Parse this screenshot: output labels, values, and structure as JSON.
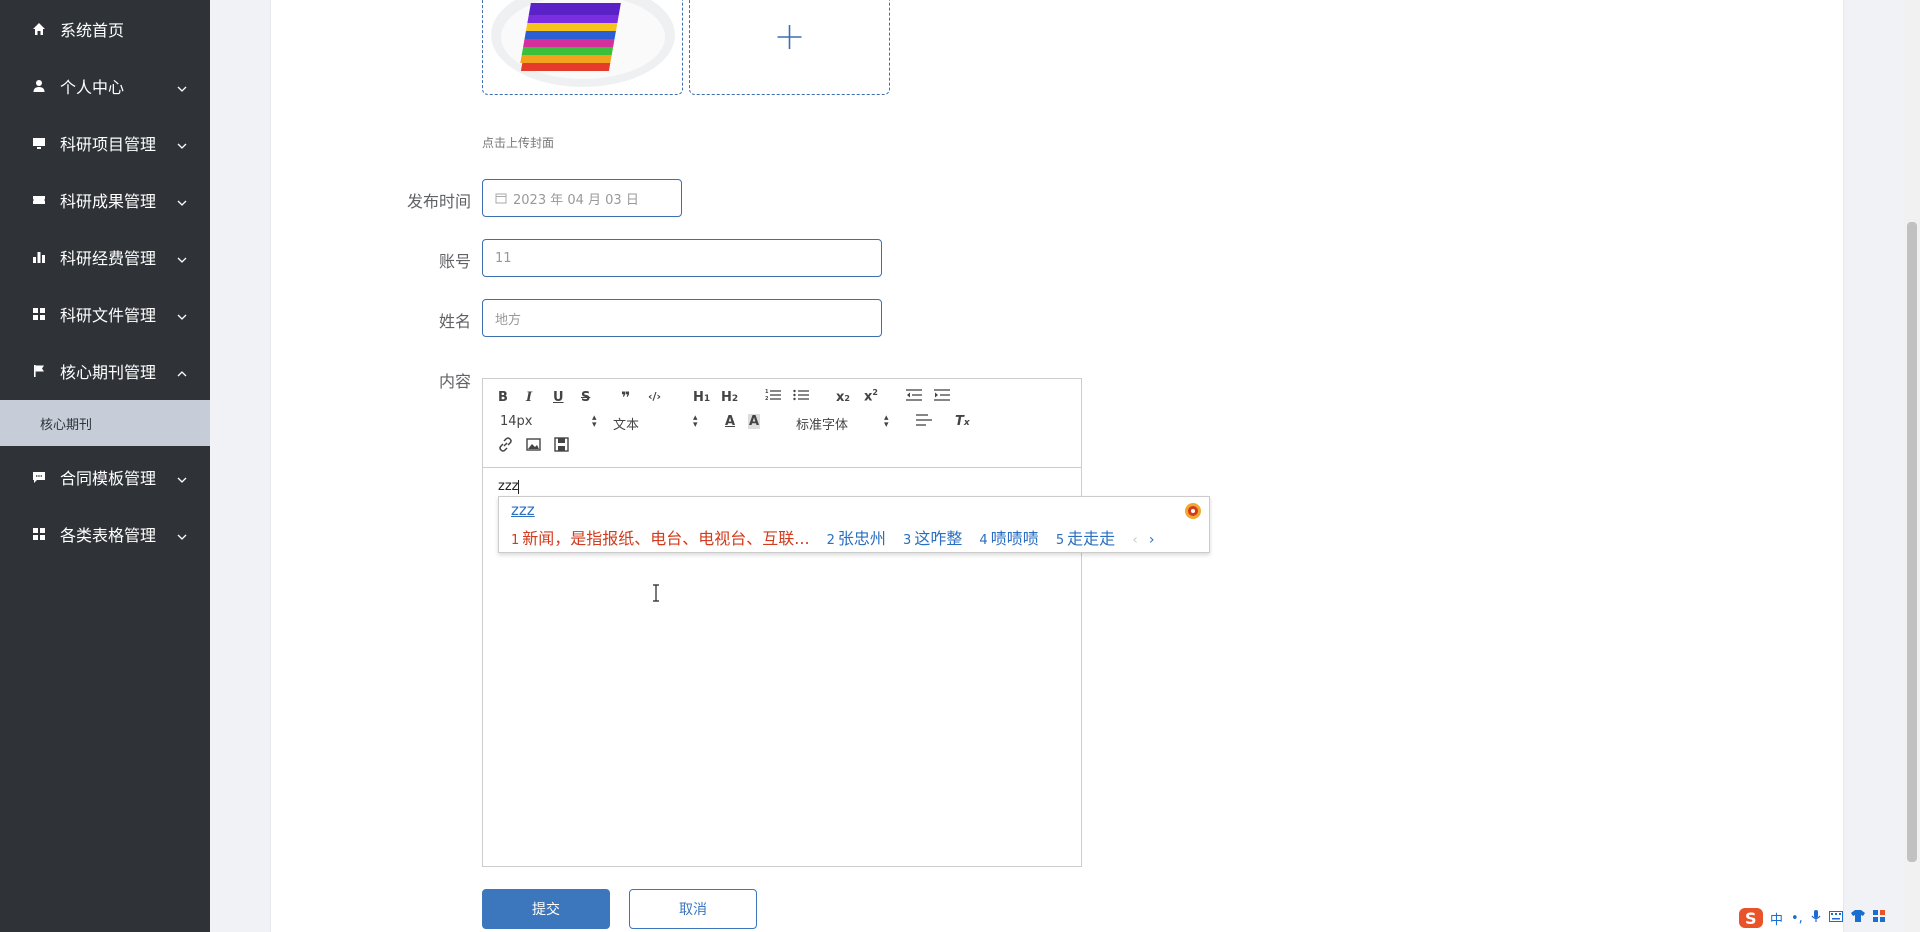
{
  "sidebar": {
    "items": [
      {
        "label": "系统首页",
        "icon": "home-icon"
      },
      {
        "label": "个人中心",
        "icon": "user-icon"
      },
      {
        "label": "科研项目管理",
        "icon": "monitor-icon"
      },
      {
        "label": "科研成果管理",
        "icon": "ticket-icon"
      },
      {
        "label": "科研经费管理",
        "icon": "bar-chart-icon"
      },
      {
        "label": "科研文件管理",
        "icon": "grid-icon"
      },
      {
        "label": "核心期刊管理",
        "icon": "flag-icon"
      },
      {
        "label": "合同模板管理",
        "icon": "chat-icon"
      },
      {
        "label": "各类表格管理",
        "icon": "grid-icon"
      }
    ],
    "sub_item": "核心期刊"
  },
  "form": {
    "cover_hint": "点击上传封面",
    "publish_time_label": "发布时间",
    "publish_time_value": "2023 年 04 月 03 日",
    "account_label": "账号",
    "account_value": "11",
    "name_label": "姓名",
    "name_value": "地方",
    "content_label": "内容",
    "content_text": "zzz",
    "submit_label": "提交",
    "cancel_label": "取消"
  },
  "editor": {
    "font_size": "14px",
    "block_type": "文本",
    "font_family": "标准字体"
  },
  "ime": {
    "composition": "zzz",
    "candidates": [
      {
        "num": "1",
        "text": "新闻，是指报纸、电台、电视台、互联..."
      },
      {
        "num": "2",
        "text": "张忠州"
      },
      {
        "num": "3",
        "text": "这咋整"
      },
      {
        "num": "4",
        "text": "啧啧啧"
      },
      {
        "num": "5",
        "text": "走走走"
      }
    ],
    "tray_mode": "中"
  },
  "colors": {
    "sidebar_bg": "#2f3337",
    "accent": "#3c76bd",
    "sub_item_bg": "#c7cdd8"
  }
}
